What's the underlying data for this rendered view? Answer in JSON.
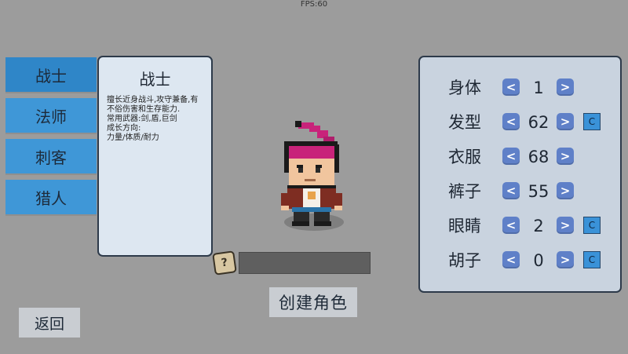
{
  "hud": {
    "fps": "FPS:60"
  },
  "classes": [
    {
      "label": "战士",
      "active": true
    },
    {
      "label": "法师",
      "active": false
    },
    {
      "label": "刺客",
      "active": false
    },
    {
      "label": "猎人",
      "active": false
    }
  ],
  "description": {
    "title": "战士",
    "lines": [
      "擅长近身战斗,攻守兼备,有",
      "不俗伤害和生存能力.",
      "常用武器:剑,盾,巨剑",
      "成长方向:",
      "力量/体质/耐力"
    ]
  },
  "name_field": {
    "value": "",
    "dice_label": "?"
  },
  "create_button": "创建角色",
  "back_button": "返回",
  "customization": {
    "left_arrow": "<",
    "right_arrow": ">",
    "color_label": "C",
    "rows": [
      {
        "label": "身体",
        "value": "1",
        "has_color": false
      },
      {
        "label": "发型",
        "value": "62",
        "has_color": true
      },
      {
        "label": "衣服",
        "value": "68",
        "has_color": false
      },
      {
        "label": "裤子",
        "value": "55",
        "has_color": false
      },
      {
        "label": "眼睛",
        "value": "2",
        "has_color": true
      },
      {
        "label": "胡子",
        "value": "0",
        "has_color": true
      }
    ]
  },
  "colors": {
    "background": "#9c9c9c",
    "tab_blue": "#3f97d7",
    "arrow_blue": "#5f80c8",
    "panel_light": "#dde7f1",
    "panel_custom": "#c9d3df",
    "hair_magenta": "#c8237a"
  }
}
